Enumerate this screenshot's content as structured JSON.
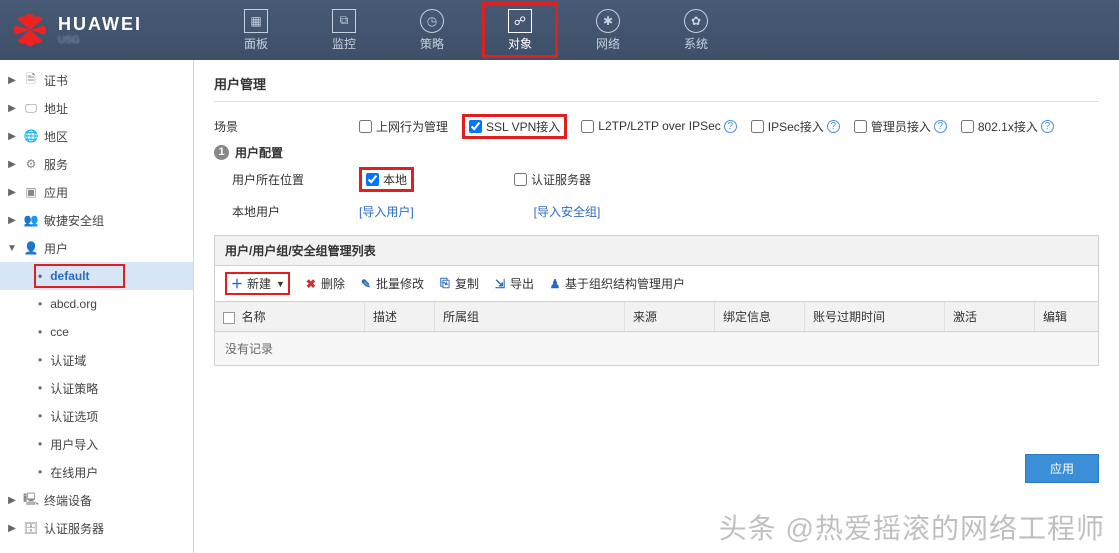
{
  "brand": {
    "name": "HUAWEI",
    "sub": "USG"
  },
  "topTabs": [
    {
      "label": "面板"
    },
    {
      "label": "监控"
    },
    {
      "label": "策略"
    },
    {
      "label": "对象"
    },
    {
      "label": "网络"
    },
    {
      "label": "系统"
    }
  ],
  "sidebar": {
    "items": [
      {
        "label": "证书",
        "type": "node"
      },
      {
        "label": "地址",
        "type": "node"
      },
      {
        "label": "地区",
        "type": "node"
      },
      {
        "label": "服务",
        "type": "node"
      },
      {
        "label": "应用",
        "type": "node"
      },
      {
        "label": "敏捷安全组",
        "type": "node"
      },
      {
        "label": "用户",
        "type": "node",
        "expanded": true
      },
      {
        "label": "default",
        "type": "child",
        "selected": true
      },
      {
        "label": "abcd.org",
        "type": "child"
      },
      {
        "label": "cce",
        "type": "child"
      },
      {
        "label": "认证域",
        "type": "child"
      },
      {
        "label": "认证策略",
        "type": "child"
      },
      {
        "label": "认证选项",
        "type": "child"
      },
      {
        "label": "用户导入",
        "type": "child"
      },
      {
        "label": "在线用户",
        "type": "child"
      },
      {
        "label": "终端设备",
        "type": "node"
      },
      {
        "label": "认证服务器",
        "type": "node"
      }
    ]
  },
  "page": {
    "title": "用户管理",
    "scenarioLabel": "场景",
    "scenarioOptions": {
      "internet": "上网行为管理",
      "sslvpn": "SSL VPN接入",
      "l2tp": "L2TP/L2TP over IPSec",
      "ipsec": "IPSec接入",
      "admin": "管理员接入",
      "dot1x": "802.1x接入"
    },
    "userConfigSection": "用户配置",
    "userLocationLabel": "用户所在位置",
    "localOpt": "本地",
    "authServerOpt": "认证服务器",
    "localUserLabel": "本地用户",
    "importUsers": "[导入用户]",
    "importGroups": "[导入安全组]",
    "tableTitle": "用户/用户组/安全组管理列表",
    "toolbar": {
      "new": "新建",
      "delete": "删除",
      "batchEdit": "批量修改",
      "copy": "复制",
      "export": "导出",
      "orgManage": "基于组织结构管理用户"
    },
    "columns": {
      "name": "名称",
      "desc": "描述",
      "group": "所属组",
      "source": "来源",
      "binding": "绑定信息",
      "expire": "账号过期时间",
      "activate": "激活",
      "edit": "编辑"
    },
    "noRecords": "没有记录",
    "applyBtn": "应用"
  },
  "watermark": "头条 @热爱摇滚的网络工程师"
}
